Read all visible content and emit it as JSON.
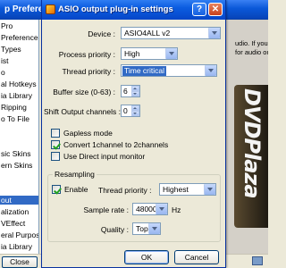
{
  "background_window": {
    "title": "p Preferences",
    "tree_items": [
      {
        "label": "Pro",
        "selected": false
      },
      {
        "label": "Preferences",
        "selected": false
      },
      {
        "label": "Types",
        "selected": false
      },
      {
        "label": "ist",
        "selected": false
      },
      {
        "label": "o",
        "selected": false
      },
      {
        "label": "al Hotkeys",
        "selected": false
      },
      {
        "label": "ia Library",
        "selected": false
      },
      {
        "label": "Ripping",
        "selected": false
      },
      {
        "label": "o To File",
        "selected": false
      },
      {
        "label": "",
        "selected": false
      },
      {
        "label": "",
        "selected": false
      },
      {
        "label": "sic Skins",
        "selected": false
      },
      {
        "label": "ern Skins",
        "selected": false
      },
      {
        "label": "",
        "selected": false
      },
      {
        "label": "",
        "selected": false
      },
      {
        "label": "out",
        "selected": true
      },
      {
        "label": "alization",
        "selected": false
      },
      {
        "label": "VEffect",
        "selected": false
      },
      {
        "label": "eral Purpose",
        "selected": false
      },
      {
        "label": "ia Library",
        "selected": false
      }
    ],
    "right_text_1": "udio. If you sel",
    "right_text_2": "for audio output",
    "logo_text": "DVDPlaza",
    "close_label": "Close"
  },
  "dialog": {
    "title": "ASIO output plug-in settings",
    "help_label": "?",
    "close_label": "✕",
    "device": {
      "label": "Device :",
      "value": "ASIO4ALL v2"
    },
    "process_priority": {
      "label": "Process priority :",
      "value": "High"
    },
    "thread_priority": {
      "label": "Thread priority :",
      "value": "Time critical"
    },
    "buffer_size": {
      "label": "Buffer size (0-63) :",
      "value": "6"
    },
    "shift_output": {
      "label": "Shift Output channels :",
      "value": "0"
    },
    "gapless": {
      "label": "Gapless mode",
      "checked": false
    },
    "convert_1ch": {
      "label": "Convert 1channel to 2channels",
      "checked": true
    },
    "direct_input": {
      "label": "Use Direct input monitor",
      "checked": false
    },
    "resampling": {
      "group_title": "Resampling",
      "enable": {
        "label": "Enable",
        "checked": true
      },
      "thread_priority": {
        "label": "Thread priority :",
        "value": "Highest"
      },
      "sample_rate": {
        "label": "Sample rate :",
        "value": "48000",
        "unit": "Hz"
      },
      "quality": {
        "label": "Quality :",
        "value": "Top"
      }
    },
    "ok_label": "OK",
    "cancel_label": "Cancel"
  },
  "colors": {
    "titlebar": "#0b5ce0",
    "selection": "#316ac5",
    "dialog_face": "#ece9d8"
  }
}
